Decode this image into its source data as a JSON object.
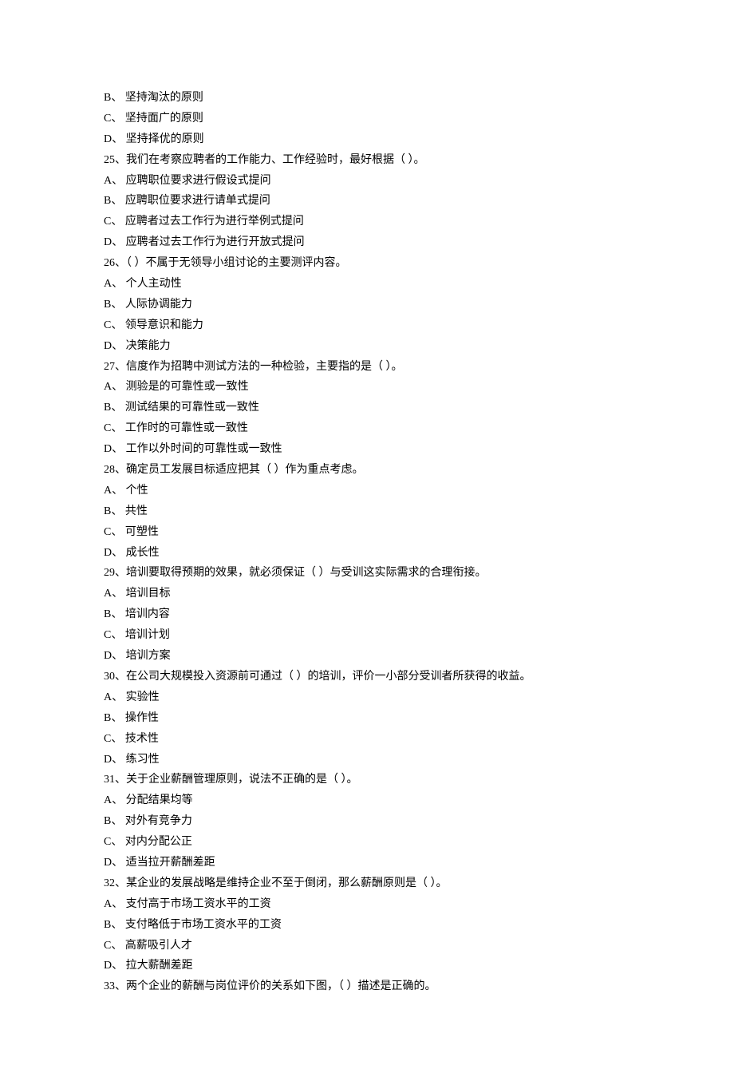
{
  "lines": [
    "B、  坚持淘汰的原则",
    "C、  坚持面广的原则",
    "D、  坚持择优的原则",
    "25、我们在考察应聘者的工作能力、工作经验时，最好根据（  ）。",
    "A、  应聘职位要求进行假设式提问",
    "B、  应聘职位要求进行请单式提问",
    "C、  应聘者过去工作行为进行举例式提问",
    "D、  应聘者过去工作行为进行开放式提问",
    "26、（  ）不属于无领导小组讨论的主要测评内容。",
    "A、  个人主动性",
    "B、  人际协调能力",
    "C、  领导意识和能力",
    "D、  决策能力",
    "27、信度作为招聘中测试方法的一种检验，主要指的是（  ）。",
    "A、  测验是的可靠性或一致性",
    "B、  测试结果的可靠性或一致性",
    "C、  工作时的可靠性或一致性",
    "D、  工作以外时间的可靠性或一致性",
    "28、确定员工发展目标适应把其（  ）作为重点考虑。",
    "A、  个性",
    "B、  共性",
    "C、  可塑性",
    "D、  成长性",
    "29、培训要取得预期的效果，就必须保证（  ）与受训这实际需求的合理衔接。",
    "A、  培训目标",
    "B、  培训内容",
    "C、  培训计划",
    "D、  培训方案",
    "30、在公司大规模投入资源前可通过（  ）的培训，评价一小部分受训者所获得的收益。",
    "A、  实验性",
    "B、  操作性",
    "C、  技术性",
    "D、  练习性",
    "31、关于企业薪酬管理原则，说法不正确的是（  ）。",
    "A、  分配结果均等",
    "B、  对外有竞争力",
    "C、  对内分配公正",
    "D、  适当拉开薪酬差距",
    "32、某企业的发展战略是维持企业不至于倒闭，那么薪酬原则是（  ）。",
    "A、  支付高于市场工资水平的工资",
    "B、  支付略低于市场工资水平的工资",
    "C、  高薪吸引人才",
    "D、  拉大薪酬差距",
    "33、两个企业的薪酬与岗位评价的关系如下图，（  ）描述是正确的。"
  ]
}
